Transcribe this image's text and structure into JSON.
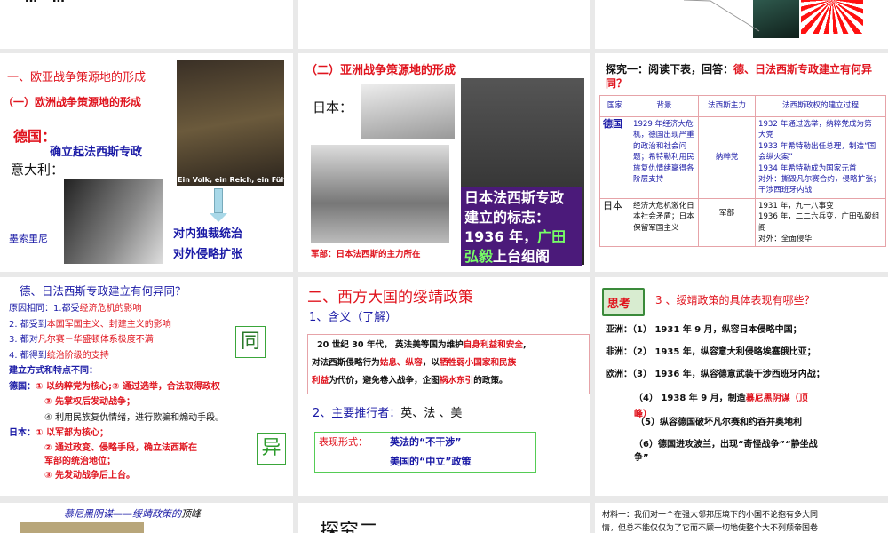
{
  "slides": {
    "top1": {
      "text": "… …"
    },
    "r2s1": {
      "title1": "一、欧亚战争策源地的形成",
      "title2": "（一）欧洲战争策源地的形成",
      "germany": "德国：",
      "germany_point": "确立起法西斯专政",
      "italy": "意大利：",
      "hitler_caption": "Ein Volk, ein Reich, ein Führer!",
      "mussolini": "墨索里尼",
      "result1": "对内独裁统治",
      "result2": "对外侵略扩张"
    },
    "r2s2": {
      "title": "（二）亚洲战争策源地的形成",
      "japan": "日本：",
      "caption": "军部：日本法西斯的主力所在",
      "box_l1": "日本法西斯专政",
      "box_l2": "建立的标志：",
      "box_l3a": "1936 年，",
      "box_l3b": "广田",
      "box_l4a": "弘毅",
      "box_l4b": "上台组阁"
    },
    "r2s3": {
      "title_black": "探究一：阅读下表，回答：",
      "title_red": "德、日法西斯专政建立有何异同？",
      "headers": [
        "国家",
        "背景",
        "法西斯主力",
        "法西斯政权的建立过程"
      ],
      "rows": [
        {
          "country": "德国",
          "background": "1929 年经济大危机，德国出现严重的政治和社会问题；希特勒利用民族复仇情绪赢得各阶层支持",
          "force": "纳粹党",
          "process": [
            "1932 年通过选举，纳粹党成为第一大党",
            "1933 年希特勒出任总理，制造“国会纵火案”",
            "1934 年希特勒成为国家元首",
            "对外：撕毁凡尔赛合约，侵略扩张；干涉西班牙内战"
          ]
        },
        {
          "country": "日本",
          "background": "经济大危机激化日本社会矛盾；日本保留军国主义",
          "force": "军部",
          "process": [
            "1931 年，九一八事变",
            "1936 年，二二六兵变，广田弘毅组阁",
            "对外：全面侵华"
          ]
        }
      ]
    },
    "r3s1": {
      "title": "德、日法西斯专政建立有何异同？",
      "same_label": "原因相同：",
      "same": [
        [
          "1.都受",
          "经济危机的影响"
        ],
        [
          "2. 都受到",
          "本国军国主义、封建主义的影响"
        ],
        [
          "3. 都对",
          "凡尔赛－华盛顿体系极度不满"
        ],
        [
          "4. 都得到",
          "统治阶级的支持"
        ]
      ],
      "diff_label": "建立方式和特点不同：",
      "de": "德国：",
      "de_items": [
        "① 以纳粹党为核心;② 通过选举，合法取得政权",
        "③ 先掌权后发动战争；",
        "④ 利用民族复仇情绪，进行欺骗和煽动手段。"
      ],
      "jp": "日本：",
      "jp_items": [
        "① 以军部为核心；",
        "② 通过政变、侵略手段，确立法西斯在",
        "军部的统治地位；",
        "③ 先发动战争后上台。"
      ],
      "tong": "同",
      "yi": "异"
    },
    "r3s2": {
      "title": "二、西方大国的绥靖政策",
      "sub1": "1、含义（了解）",
      "def": [
        [
          "20 世纪 30 年代，  英法美等国为维护",
          "自身利益和安全",
          ","
        ],
        [
          "对法西斯侵略行为",
          "姑息、纵容",
          "，以",
          "牺牲弱小国家和民族"
        ],
        [
          "利益",
          "为代价，避免卷入战争，企图",
          "祸水东引",
          "的政策。"
        ]
      ],
      "sub2": "2、主要推行者：",
      "sub2b": "英、法 、美",
      "form_label": "表现形式：",
      "form1": "英法的“不干涉”",
      "form2": "美国的“中立”政策"
    },
    "r3s3": {
      "badge": "思考",
      "question": "3 、绥靖政策的具体表现有哪些？",
      "items": [
        {
          "region": "亚洲：",
          "text": "（1） 1931 年 9 月，纵容日本侵略中国；"
        },
        {
          "region": "非洲：",
          "text": "（2） 1935 年，纵容意大利侵略埃塞俄比亚；"
        },
        {
          "region": "欧洲：",
          "text": "（3） 1936 年，纵容德意武装干涉西班牙内战；"
        }
      ],
      "item4a": "（4） 1938 年 9 月，制造",
      "item4b": "慕尼黑阴谋（顶",
      "item4c": "峰）",
      "item5": "（5）纵容德国破坏凡尔赛和约吞并奥地利",
      "item6a": "（6）德国进攻波兰，出现“奇怪战争”“静坐战",
      "item6b": "争”"
    },
    "r4s1": {
      "title_a": "慕尼黑阴谋——",
      "title_b": "绥靖政策的",
      "title_c": "顶峰"
    },
    "r4s2": {
      "title": "探究二"
    },
    "r4s3": {
      "l1": "材料一：我们对一个在强大邻邦压境下的小国不论抱有多大同",
      "l2": "情，但总不能仅仅为了它而不顾一切地使整个大不列颠帝国卷"
    }
  },
  "colors": {
    "red": "#e0141e",
    "blue": "#1a1aa6",
    "purple": "#4b1a7a",
    "green": "#3aa63a"
  }
}
